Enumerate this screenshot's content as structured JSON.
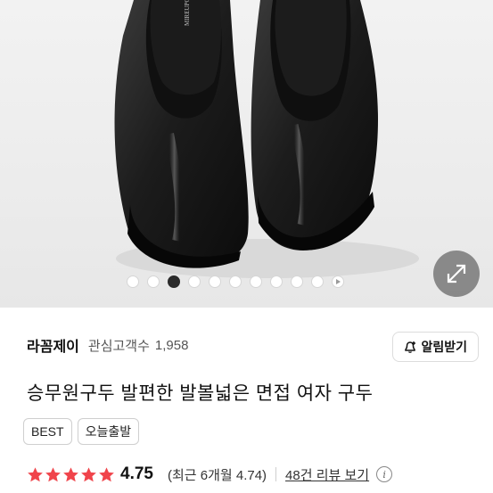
{
  "gallery": {
    "brand_print": "MIREUPO",
    "dot_count": 10,
    "active_index": 2,
    "expand_icon": "expand-arrows-icon",
    "play_icon": "play-icon"
  },
  "seller": {
    "name": "라꼼제이",
    "followers_label": "관심고객수",
    "followers_count": "1,958",
    "alarm_button": "알림받기",
    "alarm_icon": "bell-plus-icon"
  },
  "product": {
    "title": "승무원구두 발편한 발볼넓은 면접 여자 구두",
    "badges": [
      "BEST",
      "오늘출발"
    ]
  },
  "rating": {
    "stars": 5,
    "star_color": "#f0444b",
    "score": "4.75",
    "recent": "(최근 6개월 4.74)",
    "reviews_link": "48건 리뷰 보기",
    "info_icon": "info-icon"
  }
}
